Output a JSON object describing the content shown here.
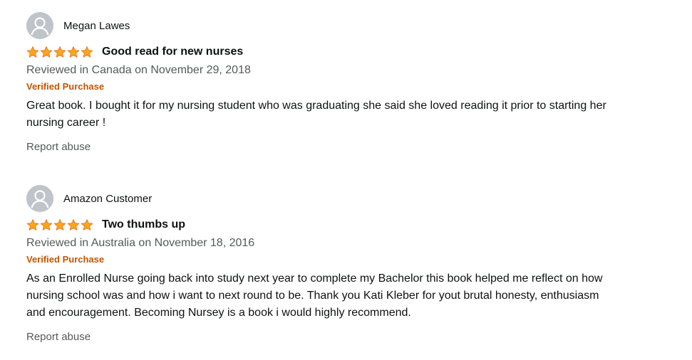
{
  "colors": {
    "star": "#FFA41C",
    "verified": "#C45500",
    "meta": "#565959",
    "text": "#0F1111"
  },
  "reviews": [
    {
      "profile_name": "Megan Lawes",
      "avatar_icon": "default-user-avatar-icon",
      "rating": 5,
      "rating_max": 5,
      "title": "Good read for new nurses",
      "date": "Reviewed in Canada on November 29, 2018",
      "verified": "Verified Purchase",
      "body": "Great book. I bought it for my nursing student who was graduating she said she loved reading it prior to starting her nursing career !",
      "report_label": "Report abuse"
    },
    {
      "profile_name": "Amazon Customer",
      "avatar_icon": "default-user-avatar-icon",
      "rating": 5,
      "rating_max": 5,
      "title": "Two thumbs up",
      "date": "Reviewed in Australia on November 18, 2016",
      "verified": "Verified Purchase",
      "body": "As an Enrolled Nurse going back into study next year to complete my Bachelor this book helped me reflect on how nursing school was and how i want to next round to be. Thank you Kati Kleber for yout brutal honesty, enthusiasm and encouragement. Becoming Nursey is a book i would highly recommend.",
      "report_label": "Report abuse"
    }
  ]
}
